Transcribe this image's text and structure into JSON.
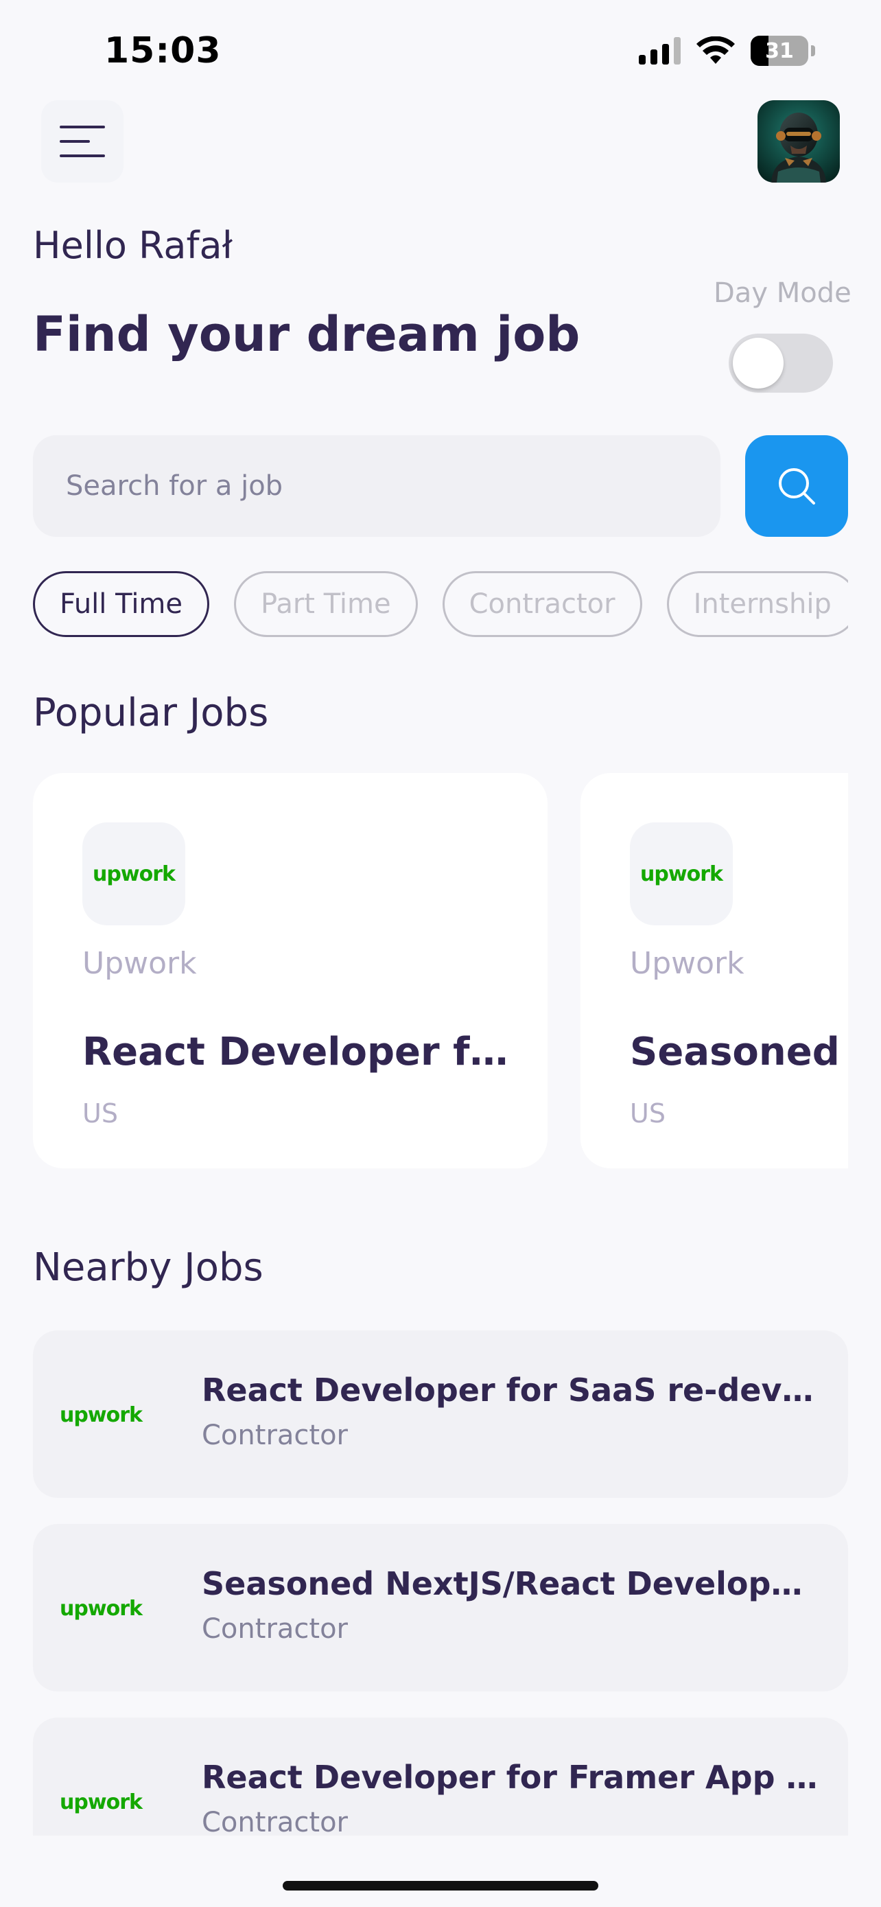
{
  "status_bar": {
    "time": "15:03",
    "battery": "31",
    "battery_level": 0.31
  },
  "header": {
    "menu_icon": "menu-icon",
    "avatar": "avatar-image"
  },
  "greeting": "Hello Rafał",
  "headline": "Find your dream job",
  "day_mode": {
    "label": "Day Mode",
    "on": false
  },
  "search": {
    "placeholder": "Search for a job",
    "value": "",
    "icon": "search-icon"
  },
  "job_types": [
    {
      "label": "Full Time",
      "active": true
    },
    {
      "label": "Part Time",
      "active": false
    },
    {
      "label": "Contractor",
      "active": false
    },
    {
      "label": "Internship",
      "active": false
    }
  ],
  "popular": {
    "title": "Popular Jobs",
    "jobs": [
      {
        "logo": "upwork",
        "company": "Upwork",
        "title": "React Developer for SaaS re-development",
        "country": "US"
      },
      {
        "logo": "upwork",
        "company": "Upwork",
        "title": "Seasoned NextJS/React Developer",
        "country": "US"
      }
    ]
  },
  "nearby": {
    "title": "Nearby Jobs",
    "jobs": [
      {
        "logo": "upwork",
        "title": "React Developer for SaaS re-development",
        "type": "Contractor"
      },
      {
        "logo": "upwork",
        "title": "Seasoned NextJS/React Developer for ongoing project",
        "type": "Contractor"
      },
      {
        "logo": "upwork",
        "title": "React Developer for Framer App - long term",
        "type": "Contractor"
      }
    ]
  },
  "logo_text": "upwork",
  "colors": {
    "primary": "#312651",
    "accent": "#1A96EF",
    "upwork_green": "#14A800",
    "muted": "#83829A",
    "background": "#F8F8FB"
  }
}
